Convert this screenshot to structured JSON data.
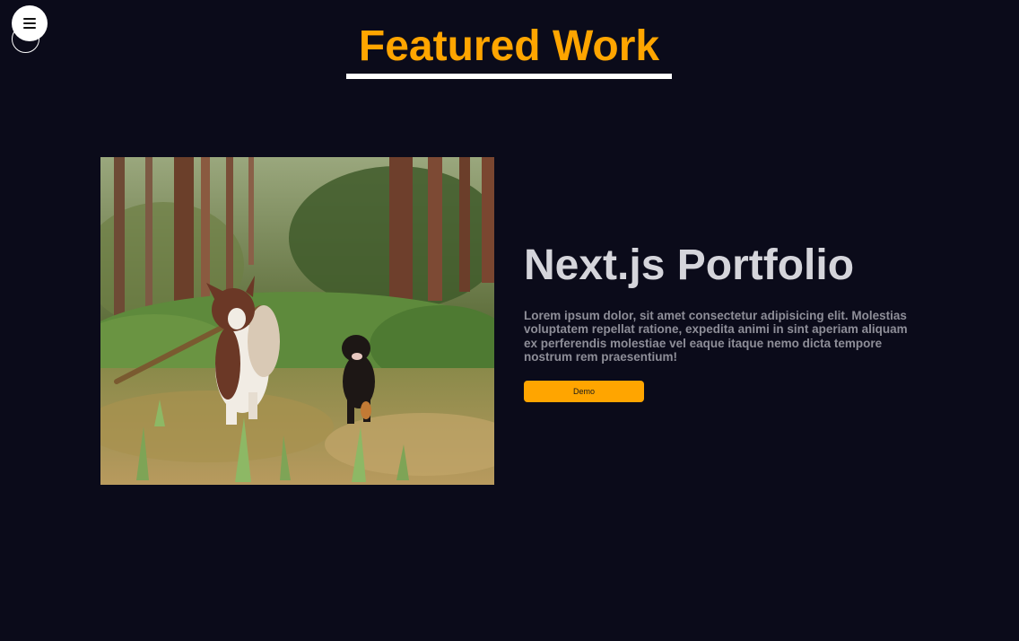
{
  "nav": {
    "menu_icon": "hamburger-menu-icon"
  },
  "section": {
    "title": "Featured Work"
  },
  "project": {
    "title": "Next.js Portfolio",
    "description": "Lorem ipsum dolor, sit amet consectetur adipisicing elit. Molestias voluptatem repellat ratione, expedita animi in sint aperiam aliquam ex perferendis molestiae vel eaque itaque nemo dicta tempore nostrum rem praesentium!",
    "demo_label": "Demo",
    "image_alt": "Two dogs running in a forest, one carrying a stick"
  },
  "colors": {
    "background": "#0b0b1a",
    "accent": "#ffa500",
    "title_text": "#d5d5db",
    "body_text": "#8e8e98"
  }
}
